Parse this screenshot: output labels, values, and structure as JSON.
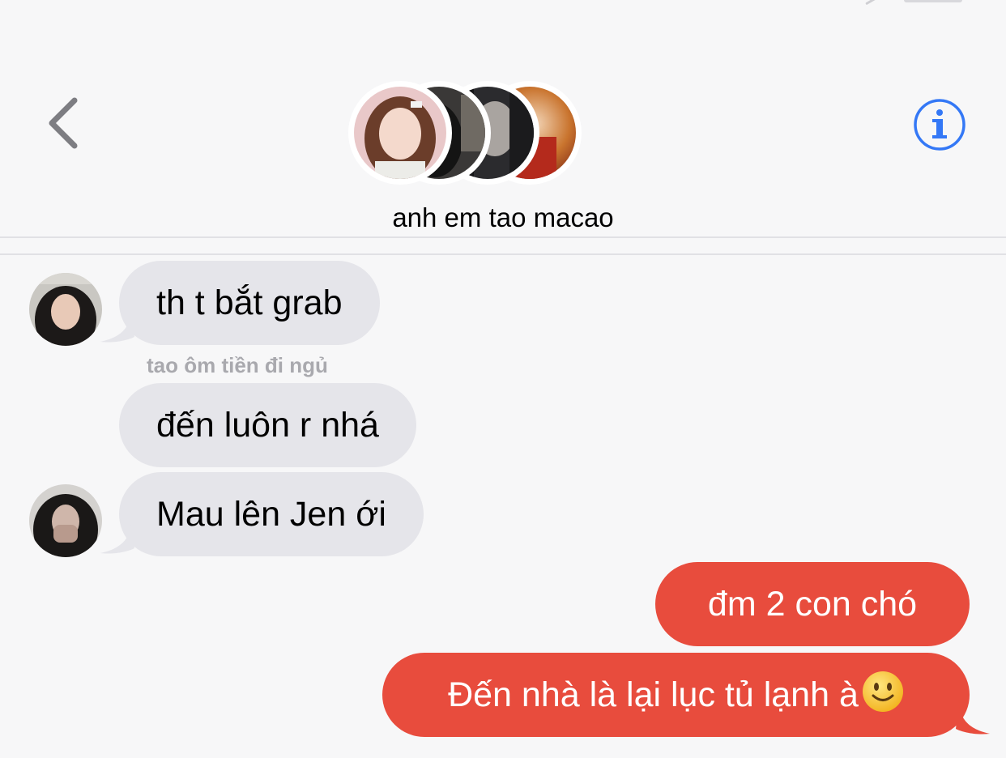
{
  "header": {
    "group_name": "anh em tao macao",
    "back_icon": "chevron-left-icon",
    "info_icon": "info-circle-icon",
    "accent_color": "#3478f6"
  },
  "messages": [
    {
      "direction": "incoming",
      "text": "th t bắt grab"
    },
    {
      "direction": "incoming",
      "sender": "tao ôm tiền đi ngủ",
      "text": "đến luôn r nhá"
    },
    {
      "direction": "incoming",
      "text": "Mau lên Jen ới"
    },
    {
      "direction": "outgoing",
      "text": "đm 2 con chó"
    },
    {
      "direction": "outgoing",
      "text": "Đến nhà là lại lục tủ lạnh à",
      "emoji": "slightly-smiling-face-icon"
    }
  ],
  "colors": {
    "incoming_bubble": "#e5e5ea",
    "outgoing_bubble": "#e84c3d",
    "background": "#f7f7f8"
  }
}
